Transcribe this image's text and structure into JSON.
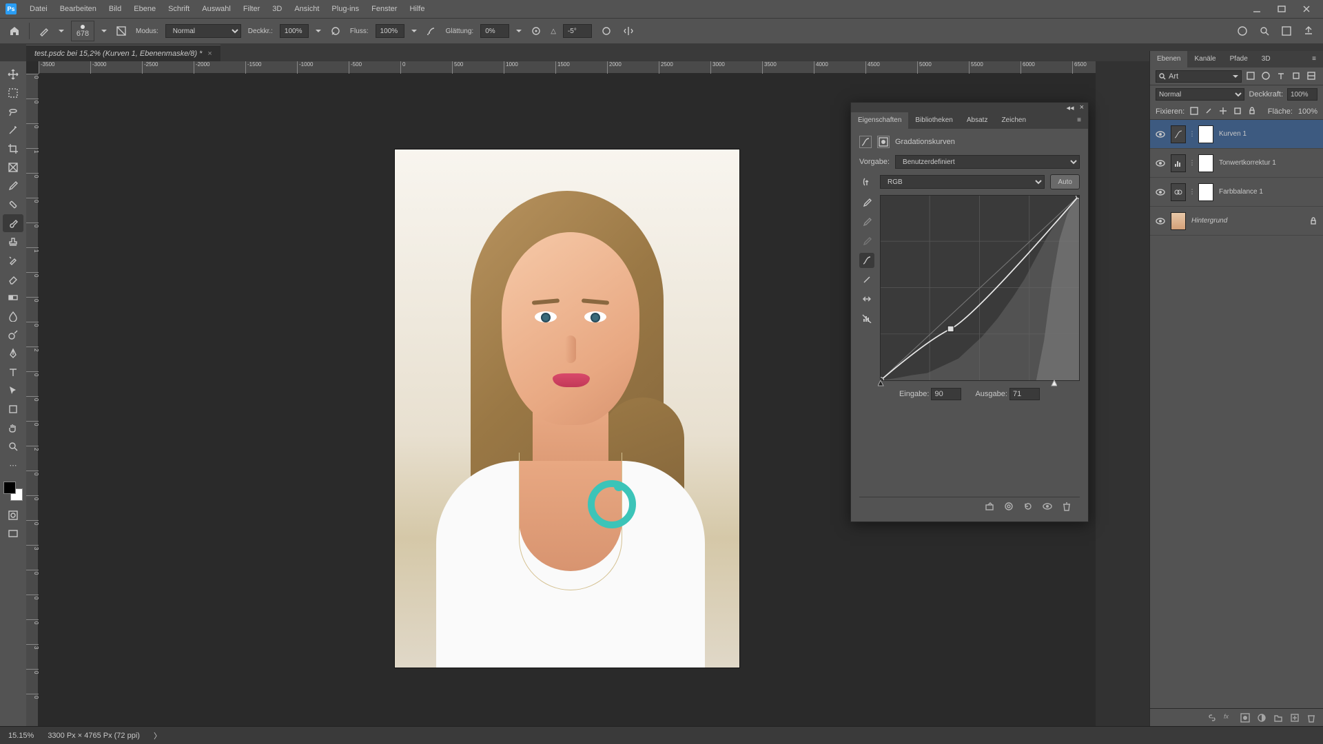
{
  "menu": {
    "items": [
      "Datei",
      "Bearbeiten",
      "Bild",
      "Ebene",
      "Schrift",
      "Auswahl",
      "Filter",
      "3D",
      "Ansicht",
      "Plug-ins",
      "Fenster",
      "Hilfe"
    ]
  },
  "optbar": {
    "brush_size": "678",
    "mode_label": "Modus:",
    "mode_value": "Normal",
    "opacity_label": "Deckkr.:",
    "opacity_value": "100%",
    "flow_label": "Fluss:",
    "flow_value": "100%",
    "smooth_label": "Glättung:",
    "smooth_value": "0%",
    "angle_label": "△",
    "angle_value": "-5°"
  },
  "tab": {
    "title": "test.psdc bei 15,2% (Kurven 1, Ebenenmaske/8) *"
  },
  "ruler_h": [
    "-3500",
    "-3000",
    "-2500",
    "-2000",
    "-1500",
    "-1000",
    "-500",
    "0",
    "500",
    "1000",
    "1500",
    "2000",
    "2500",
    "3000",
    "3500",
    "4000",
    "4500",
    "5000",
    "5500",
    "6000",
    "6500"
  ],
  "ruler_v": [
    "0",
    "0",
    "0",
    "1",
    "0",
    "0",
    "0",
    "1",
    "0",
    "0",
    "0",
    "2",
    "0",
    "0",
    "0",
    "2",
    "0",
    "0",
    "0",
    "3",
    "0",
    "0",
    "0",
    "3",
    "0",
    "0"
  ],
  "prop": {
    "tabs": [
      "Eigenschaften",
      "Bibliotheken",
      "Absatz",
      "Zeichen"
    ],
    "title": "Gradationskurven",
    "preset_label": "Vorgabe:",
    "preset_value": "Benutzerdefiniert",
    "channel_value": "RGB",
    "auto": "Auto",
    "input_label": "Eingabe:",
    "input_value": "90",
    "output_label": "Ausgabe:",
    "output_value": "71"
  },
  "layers_panel": {
    "tabs": [
      "Ebenen",
      "Kanäle",
      "Pfade",
      "3D"
    ],
    "filter_label": "Art",
    "blend_value": "Normal",
    "opacity_label": "Deckkraft:",
    "opacity_value": "100%",
    "lock_label": "Fixieren:",
    "fill_label": "Fläche:",
    "fill_value": "100%",
    "items": [
      {
        "name": "Kurven 1",
        "type": "curves",
        "selected": true
      },
      {
        "name": "Tonwertkorrektur 1",
        "type": "levels",
        "selected": false
      },
      {
        "name": "Farbbalance 1",
        "type": "balance",
        "selected": false
      },
      {
        "name": "Hintergrund",
        "type": "bg",
        "selected": false,
        "locked": true,
        "italic": true
      }
    ]
  },
  "status": {
    "zoom": "15.15%",
    "docinfo": "3300 Px × 4765 Px (72 ppi)"
  },
  "chart_data": {
    "type": "line",
    "title": "Gradationskurve RGB",
    "xlabel": "Eingabe",
    "ylabel": "Ausgabe",
    "xlim": [
      0,
      255
    ],
    "ylim": [
      0,
      255
    ],
    "series": [
      {
        "name": "Kurve",
        "x": [
          0,
          90,
          255
        ],
        "y": [
          0,
          71,
          255
        ]
      },
      {
        "name": "Diagonale",
        "x": [
          0,
          255
        ],
        "y": [
          0,
          255
        ]
      }
    ],
    "histogram_peaks": "stark rechtslastig, Hauptmasse bei 200-255, kleiner Hügel um 120"
  }
}
